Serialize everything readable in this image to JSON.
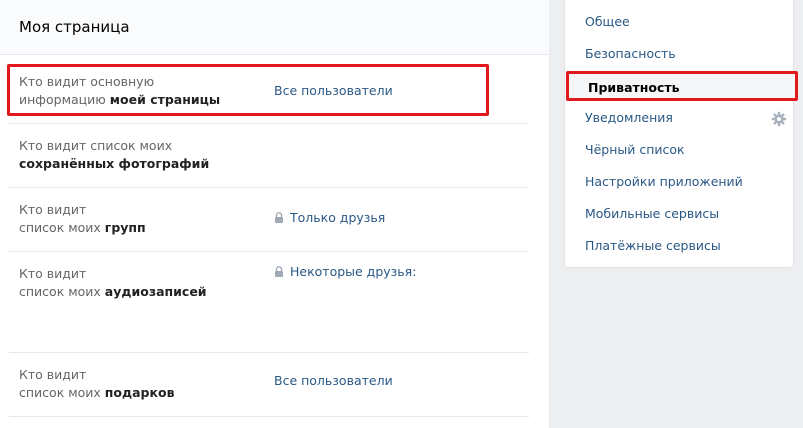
{
  "main": {
    "title": "Моя страница",
    "rows": [
      {
        "label_plain": "Кто видит основную",
        "label_plain2": "информацию ",
        "label_bold": "моей страницы",
        "value": "Все пользователи",
        "locked": false
      },
      {
        "label_plain": "Кто видит список моих",
        "label_plain2": "",
        "label_bold": "сохранённых фотографий",
        "value": "",
        "locked": false
      },
      {
        "label_plain": "Кто видит",
        "label_plain2": "список моих ",
        "label_bold": "групп",
        "value": "Только друзья",
        "locked": true
      },
      {
        "label_plain": "Кто видит",
        "label_plain2": "список моих ",
        "label_bold": "аудиозаписей",
        "value": "Некоторые друзья:",
        "locked": true
      },
      {
        "label_plain": "Кто видит",
        "label_plain2": "список моих ",
        "label_bold": "подарков",
        "value": "Все пользователи",
        "locked": false
      }
    ]
  },
  "sidebar": {
    "items": [
      {
        "label": "Общее"
      },
      {
        "label": "Безопасность"
      },
      {
        "label": "Приватность"
      },
      {
        "label": "Уведомления"
      },
      {
        "label": "Чёрный список"
      },
      {
        "label": "Настройки приложений"
      },
      {
        "label": "Мобильные сервисы"
      },
      {
        "label": "Платёжные сервисы"
      }
    ],
    "active_index": 2
  },
  "colors": {
    "accent_link": "#2a5885",
    "highlight_border": "#e1181c",
    "page_bg": "#edeef0"
  },
  "icons": {
    "lock": "lock-icon",
    "gear": "gear-icon"
  }
}
